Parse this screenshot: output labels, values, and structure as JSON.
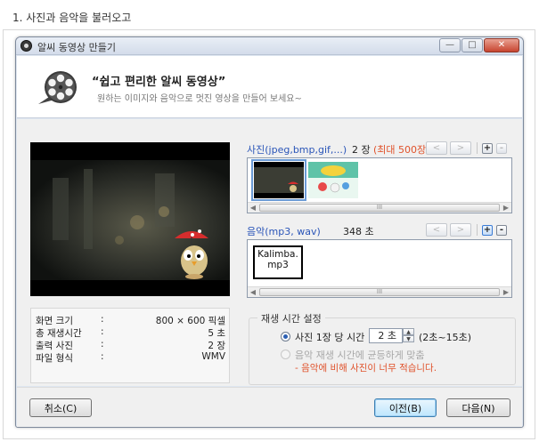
{
  "doc": {
    "heading": "1. 사진과 음악을 불러오고"
  },
  "window": {
    "title": "알씨 동영상 만들기",
    "controls": {
      "minimize": "—",
      "maximize": "□",
      "close": "✕"
    }
  },
  "header": {
    "tagline": "“쉽고 편리한 알씨 동영상”",
    "subtitle": "원하는 이미지와 음악으로 멋진 영상을 만들어 보세요~",
    "logo_icon": "film-reel-icon"
  },
  "preview": {
    "prev_symbol": "<",
    "next_symbol": ">"
  },
  "info": {
    "rows": [
      {
        "label": "화면 크기",
        "colon": ":",
        "value": "800 × 600 픽셀"
      },
      {
        "label": "총 재생시간",
        "colon": ":",
        "value": "5 초"
      },
      {
        "label": "출력 사진",
        "colon": ":",
        "value": "2 장"
      },
      {
        "label": "파일 형식",
        "colon": ":",
        "value": "WMV"
      }
    ]
  },
  "photos": {
    "label": "사진(jpeg,bmp,gif,...)",
    "count": "2 장",
    "max": "(최대 500장)",
    "prev_symbol": "<",
    "next_symbol": ">",
    "add_symbol": "+",
    "remove_symbol": "-",
    "scroll_left": "◀",
    "scroll_right": "▶",
    "scroll_grip": "III"
  },
  "music": {
    "label": "음악(mp3, wav)",
    "duration": "348 초",
    "prev_symbol": "<",
    "next_symbol": ">",
    "add_symbol": "+",
    "remove_symbol": "-",
    "item": "Kalimba.mp3",
    "scroll_left": "◀",
    "scroll_right": "▶",
    "scroll_grip": "III"
  },
  "playback": {
    "title": "재생 시간 설정",
    "option1_label": "사진 1장 당 시간",
    "seconds_value": "2 초",
    "range": "(2초~15초)",
    "option2_label": "음악 재생 시간에 균등하게 맞춤",
    "warning": "- 음악에 비해 사진이 너무 적습니다."
  },
  "footer": {
    "cancel": "취소(C)",
    "prev": "이전(B)",
    "next": "다음(N)"
  },
  "colors": {
    "section_label": "#2a55b8",
    "warning": "#e0522b",
    "window_frame": "#dfe7f1"
  }
}
